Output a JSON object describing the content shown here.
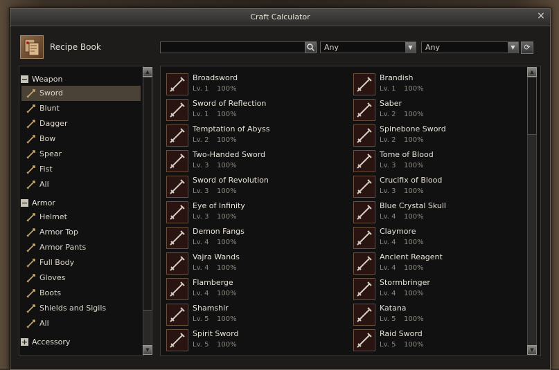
{
  "window": {
    "title": "Craft Calculator",
    "close": "×"
  },
  "toolbar": {
    "recipe_book": "Recipe Book",
    "search_value": "",
    "filter1": "Any",
    "filter2": "Any"
  },
  "categories": {
    "weapon": {
      "label": "Weapon",
      "toggle": "−",
      "items": [
        "Sword",
        "Blunt",
        "Dagger",
        "Bow",
        "Spear",
        "Fist",
        "All"
      ]
    },
    "armor": {
      "label": "Armor",
      "toggle": "−",
      "items": [
        "Helmet",
        "Armor Top",
        "Armor Pants",
        "Full Body",
        "Gloves",
        "Boots",
        "Shields and Sigils",
        "All"
      ]
    },
    "accessory": {
      "label": "Accessory",
      "toggle": "+"
    }
  },
  "selected_category": "Sword",
  "recipes_left": [
    {
      "name": "Broadsword",
      "level": "Lv. 1",
      "rate": "100%"
    },
    {
      "name": "Sword of Reflection",
      "level": "Lv. 1",
      "rate": "100%"
    },
    {
      "name": "Temptation of Abyss",
      "level": "Lv. 2",
      "rate": "100%"
    },
    {
      "name": "Two-Handed Sword",
      "level": "Lv. 3",
      "rate": "100%"
    },
    {
      "name": "Sword of Revolution",
      "level": "Lv. 3",
      "rate": "100%"
    },
    {
      "name": "Eye of Infinity",
      "level": "Lv. 3",
      "rate": "100%"
    },
    {
      "name": "Demon Fangs",
      "level": "Lv. 4",
      "rate": "100%"
    },
    {
      "name": "Vajra Wands",
      "level": "Lv. 4",
      "rate": "100%"
    },
    {
      "name": "Flamberge",
      "level": "Lv. 4",
      "rate": "100%"
    },
    {
      "name": "Shamshir",
      "level": "Lv. 5",
      "rate": "100%"
    },
    {
      "name": "Spirit Sword",
      "level": "Lv. 5",
      "rate": "100%"
    }
  ],
  "recipes_right": [
    {
      "name": "Brandish",
      "level": "Lv. 1",
      "rate": "100%"
    },
    {
      "name": "Saber",
      "level": "Lv. 2",
      "rate": "100%"
    },
    {
      "name": "Spinebone Sword",
      "level": "Lv. 2",
      "rate": "100%"
    },
    {
      "name": "Tome of Blood",
      "level": "Lv. 3",
      "rate": "100%"
    },
    {
      "name": "Crucifix of Blood",
      "level": "Lv. 3",
      "rate": "100%"
    },
    {
      "name": "Blue Crystal Skull",
      "level": "Lv. 4",
      "rate": "100%"
    },
    {
      "name": "Claymore",
      "level": "Lv. 4",
      "rate": "100%"
    },
    {
      "name": "Ancient Reagent",
      "level": "Lv. 4",
      "rate": "100%"
    },
    {
      "name": "Stormbringer",
      "level": "Lv. 4",
      "rate": "100%"
    },
    {
      "name": "Katana",
      "level": "Lv. 5",
      "rate": "100%"
    },
    {
      "name": "Raid Sword",
      "level": "Lv. 5",
      "rate": "100%"
    }
  ],
  "colors": {
    "accent": "#c8b89a",
    "selected_row": "#4a4237",
    "icon_bg": "#2a1412"
  }
}
